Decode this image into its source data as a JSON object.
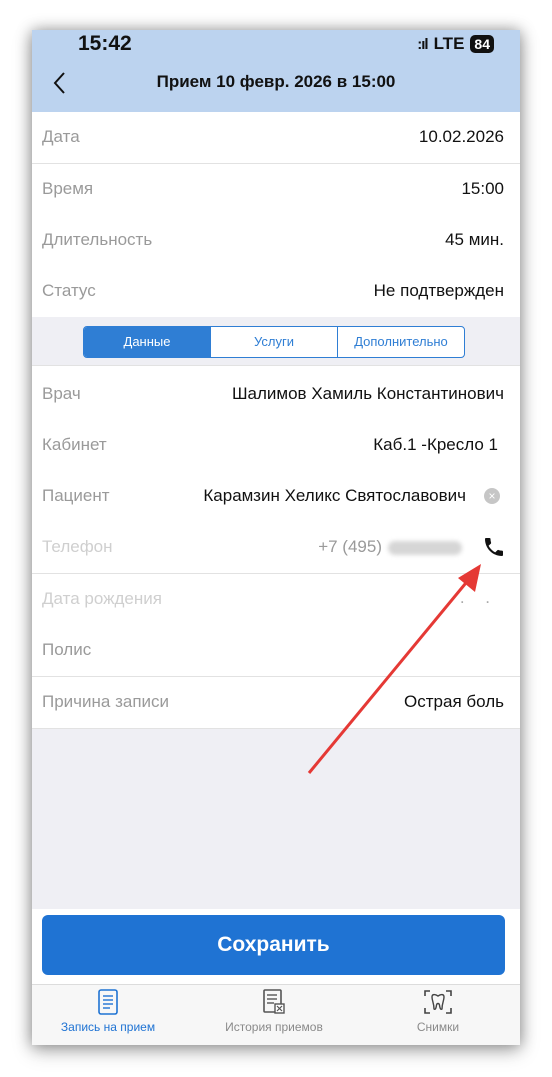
{
  "status_bar": {
    "time": "15:42",
    "signal": ":ıl",
    "network": "LTE",
    "battery": "84"
  },
  "header": {
    "title": "Прием 10 февр. 2026 в 15:00"
  },
  "summary": [
    {
      "label": "Дата",
      "value": "10.02.2026"
    },
    {
      "label": "Время",
      "value": "15:00"
    },
    {
      "label": "Длительность",
      "value": "45 мин."
    },
    {
      "label": "Статус",
      "value": "Не подтвержден"
    }
  ],
  "tabs": {
    "items": [
      "Данные",
      "Услуги",
      "Дополнительно"
    ],
    "active": "Данные"
  },
  "details": {
    "doctor": {
      "label": "Врач",
      "value": "Шалимов Хамиль Константинович"
    },
    "cabinet": {
      "label": "Кабинет",
      "value": "Каб.1 -Кресло 1"
    },
    "patient": {
      "label": "Пациент",
      "value": "Карамзин Хеликс Святославович"
    },
    "phone": {
      "label": "Телефон",
      "value": "+7 (495)"
    },
    "birthdate": {
      "label": "Дата рождения",
      "value": ". ."
    },
    "policy": {
      "label": "Полис",
      "value": ""
    },
    "reason": {
      "label": "Причина записи",
      "value": "Острая боль"
    }
  },
  "save_label": "Сохранить",
  "tabbar": [
    {
      "label": "Запись на прием",
      "icon": "document-icon",
      "active": true
    },
    {
      "label": "История приемов",
      "icon": "history-icon",
      "active": false
    },
    {
      "label": "Снимки",
      "icon": "tooth-icon",
      "active": false
    }
  ],
  "colors": {
    "accent": "#1f73d3",
    "header_bg": "#bcd3ef",
    "annotation": "#e53935"
  }
}
